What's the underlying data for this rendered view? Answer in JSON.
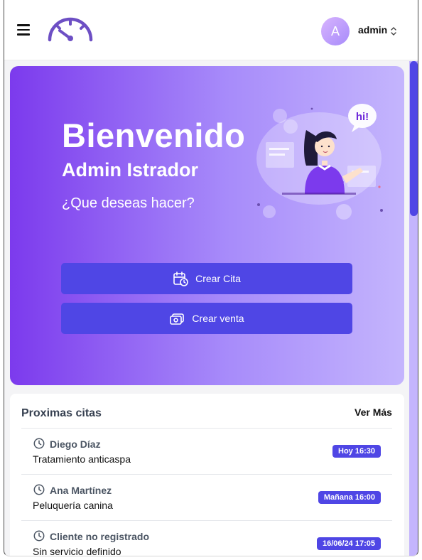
{
  "header": {
    "avatar_initial": "A",
    "user_name": "admin",
    "accent_color": "#4f46e5"
  },
  "hero": {
    "title": "Bienvenido",
    "subtitle": "Admin Istrador",
    "question": "¿Que deseas hacer?",
    "greeting_bubble": "hi!",
    "gradient": [
      "#7c3aed",
      "#c4b5fd"
    ],
    "actions": [
      {
        "label": "Crear Cita",
        "icon": "calendar-clock-icon"
      },
      {
        "label": "Crear venta",
        "icon": "cash-icon"
      }
    ]
  },
  "appointments": {
    "title": "Proximas citas",
    "more_label": "Ver Más",
    "items": [
      {
        "client": "Diego Díaz",
        "service": "Tratamiento anticaspa",
        "when": "Hoy 16:30"
      },
      {
        "client": "Ana Martínez",
        "service": "Peluquería canina",
        "when": "Mañana 16:00"
      },
      {
        "client": "Cliente no registrado",
        "service": "Sin servicio definido",
        "when": "16/06/24 17:05"
      }
    ]
  }
}
